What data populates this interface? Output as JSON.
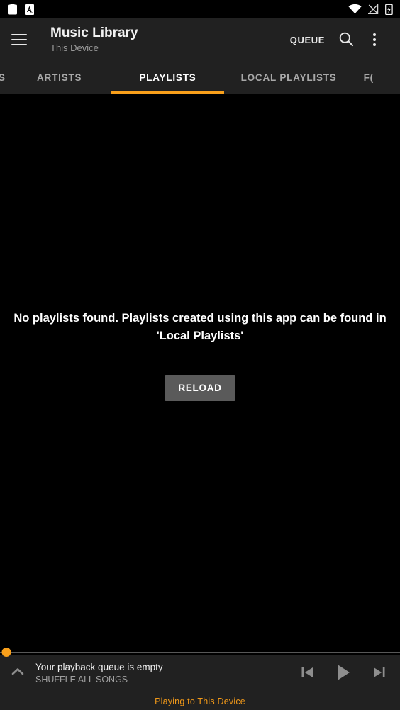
{
  "status_bar": {
    "left_icons": [
      {
        "name": "clipboard-notification-icon",
        "glyph": "clipboard"
      },
      {
        "name": "font-app-notification-icon",
        "glyph": "A"
      }
    ],
    "right_icons": [
      {
        "name": "wifi-icon",
        "glyph": "wifi"
      },
      {
        "name": "no-signal-icon",
        "glyph": "signal-off"
      },
      {
        "name": "battery-charging-icon",
        "glyph": "battery-bolt"
      }
    ]
  },
  "app_bar": {
    "menu_icon": "hamburger-menu-icon",
    "title": "Music Library",
    "subtitle": "This Device",
    "queue_label": "QUEUE",
    "search_icon": "search-icon",
    "overflow_icon": "more-vertical-icon"
  },
  "tabs": {
    "items": [
      {
        "label": "S",
        "active": false,
        "clipped": "left"
      },
      {
        "label": "ARTISTS",
        "active": false,
        "clipped": "none"
      },
      {
        "label": "PLAYLISTS",
        "active": true,
        "clipped": "none"
      },
      {
        "label": "LOCAL PLAYLISTS",
        "active": false,
        "clipped": "none"
      },
      {
        "label": "F(",
        "active": false,
        "clipped": "right"
      }
    ],
    "indicator_color": "#f9a01b"
  },
  "content": {
    "empty_message": "No playlists found. Playlists created using this app can be found in 'Local Playlists'",
    "reload_label": "RELOAD"
  },
  "player": {
    "seek_position_percent": 0,
    "thumb_color": "#f9a01b",
    "expand_icon": "chevron-up-icon",
    "track_title": "Your playback queue is empty",
    "track_subtitle": "SHUFFLE ALL SONGS",
    "previous_icon": "skip-previous-icon",
    "play_icon": "play-icon",
    "next_icon": "skip-next-icon"
  },
  "cast_footer": {
    "text": "Playing to This Device",
    "color": "#f09819"
  }
}
